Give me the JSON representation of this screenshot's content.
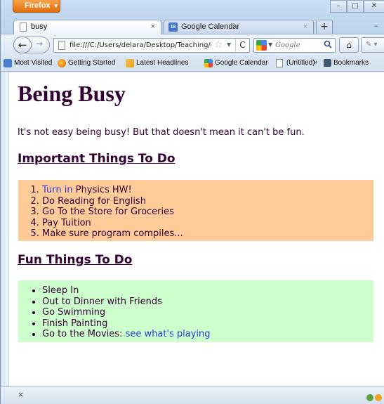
{
  "window": {
    "app_button": "Firefox",
    "controls": {
      "minimize": "–",
      "maximize": "□",
      "close": "✕"
    }
  },
  "tabs": [
    {
      "label": "busy",
      "active": true,
      "icon": "page-icon"
    },
    {
      "label": "Google Calendar",
      "active": false,
      "icon": "google-calendar-icon",
      "icon_text": "18"
    }
  ],
  "tab_controls": {
    "new_tab": "+",
    "close": "×",
    "overflow": "–"
  },
  "navbar": {
    "url": "file:///C:/Users/delara/Desktop/Teaching/cs",
    "search_engine": "Google",
    "search_placeholder": "Google",
    "back": "←",
    "forward": "→",
    "reload": "C",
    "home": "⌂"
  },
  "bookmarks": [
    {
      "label": "Most Visited",
      "icon": "most-visited-icon"
    },
    {
      "label": "Getting Started",
      "icon": "firefox-icon"
    },
    {
      "label": "Latest Headlines",
      "icon": "rss-icon"
    },
    {
      "label": "Google Calendar",
      "icon": "google-icon"
    },
    {
      "label": "(Untitled)",
      "icon": "page-icon"
    }
  ],
  "bookmarks_overflow": "»",
  "bookmarks_menu": "Bookmarks",
  "page": {
    "title": "Being Busy",
    "intro": "It's not easy being busy! But that doesn't mean it can't be fun.",
    "important": {
      "heading": "Important Things To Do",
      "background": "#ffcc99",
      "items": [
        {
          "link": "Turn in",
          "text": " Physics HW!"
        },
        {
          "text": "Do Reading for English"
        },
        {
          "text": "Go To the Store for Groceries"
        },
        {
          "text": "Pay Tuition"
        },
        {
          "text": "Make sure program compiles..."
        }
      ]
    },
    "fun": {
      "heading": "Fun Things To Do",
      "background": "#ccffcc",
      "items": [
        {
          "text": "Sleep In"
        },
        {
          "text": "Out to Dinner with Friends"
        },
        {
          "text": "Go Swimming"
        },
        {
          "text": "Finish Painting"
        },
        {
          "text": "Go to the Movies: ",
          "link": "see what's playing"
        }
      ]
    },
    "text_color": "#330033",
    "link_color": "#2a3bd6"
  },
  "statusbar": {
    "close": "×"
  }
}
